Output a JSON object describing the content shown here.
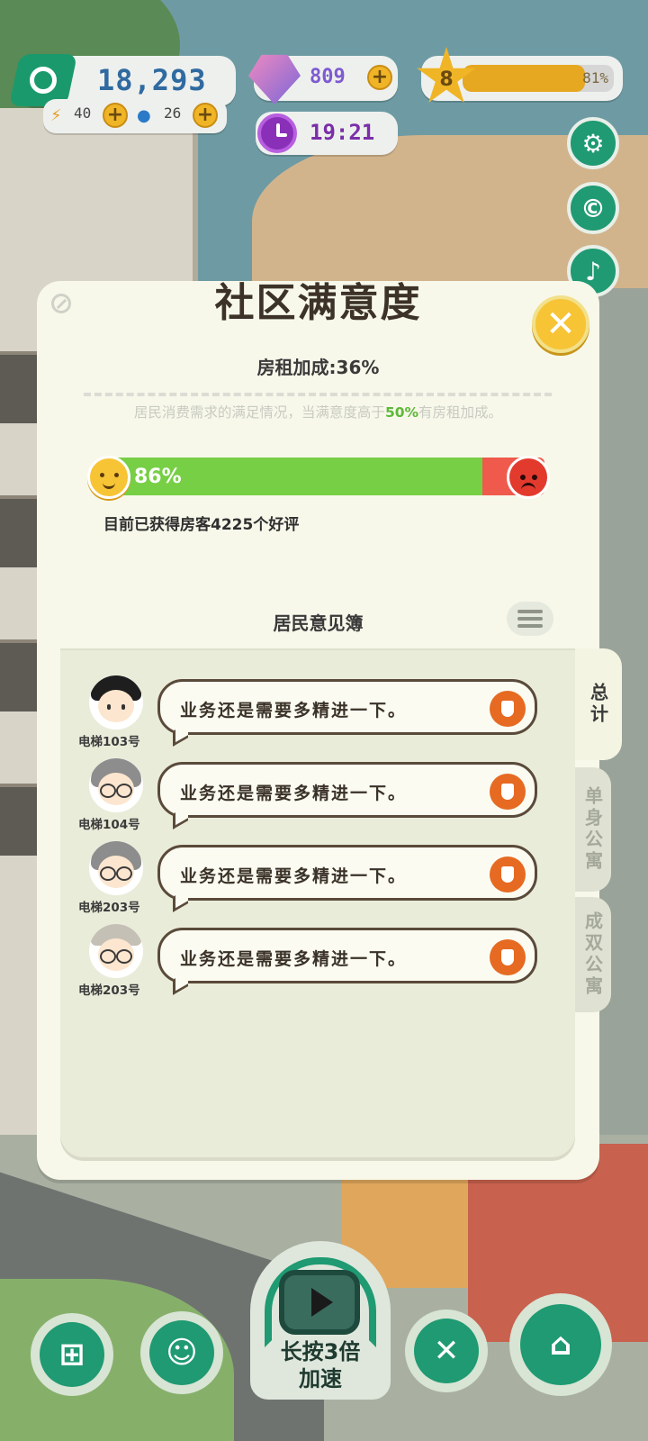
{
  "hud": {
    "money": "18,293",
    "energy": "40",
    "water": "26",
    "gems": "809",
    "level": "8",
    "xp_percent_label": "81%",
    "xp_fraction": 0.81,
    "timer": "19:21"
  },
  "side_buttons": [
    "gear-icon",
    "coupon-icon",
    "bell-icon"
  ],
  "panel": {
    "title": "社区满意度",
    "close_label": "✕",
    "rent_bonus": "房租加成:36%",
    "description_before": "居民消费需求的满足情况，当满意度高于",
    "description_threshold": "50%",
    "description_after": "有房租加成。",
    "satisfaction_label": "86%",
    "satisfaction_fraction": 0.86,
    "reviews_text": "目前已获得房客4225个好评",
    "book_title": "居民意见簿",
    "comments": [
      {
        "room": "电梯103号",
        "text": "业务还是需要多精进一下。",
        "avatar": "black-hair"
      },
      {
        "room": "电梯104号",
        "text": "业务还是需要多精进一下。",
        "avatar": "gray-hair-glasses"
      },
      {
        "room": "电梯203号",
        "text": "业务还是需要多精进一下。",
        "avatar": "gray-hair-glasses"
      },
      {
        "room": "电梯203号",
        "text": "业务还是需要多精进一下。",
        "avatar": "bald-glasses"
      }
    ],
    "tabs": {
      "total": "总计",
      "single": "单身公寓",
      "double": "成双公寓"
    }
  },
  "bottom": {
    "speed_label_line1": "长按3倍",
    "speed_label_line2": "加速"
  },
  "colors": {
    "accent_green": "#1f9a72",
    "satisfaction_green": "#77cf45",
    "dissatisfaction_red": "#ef5a4d",
    "gold": "#f0b526"
  }
}
